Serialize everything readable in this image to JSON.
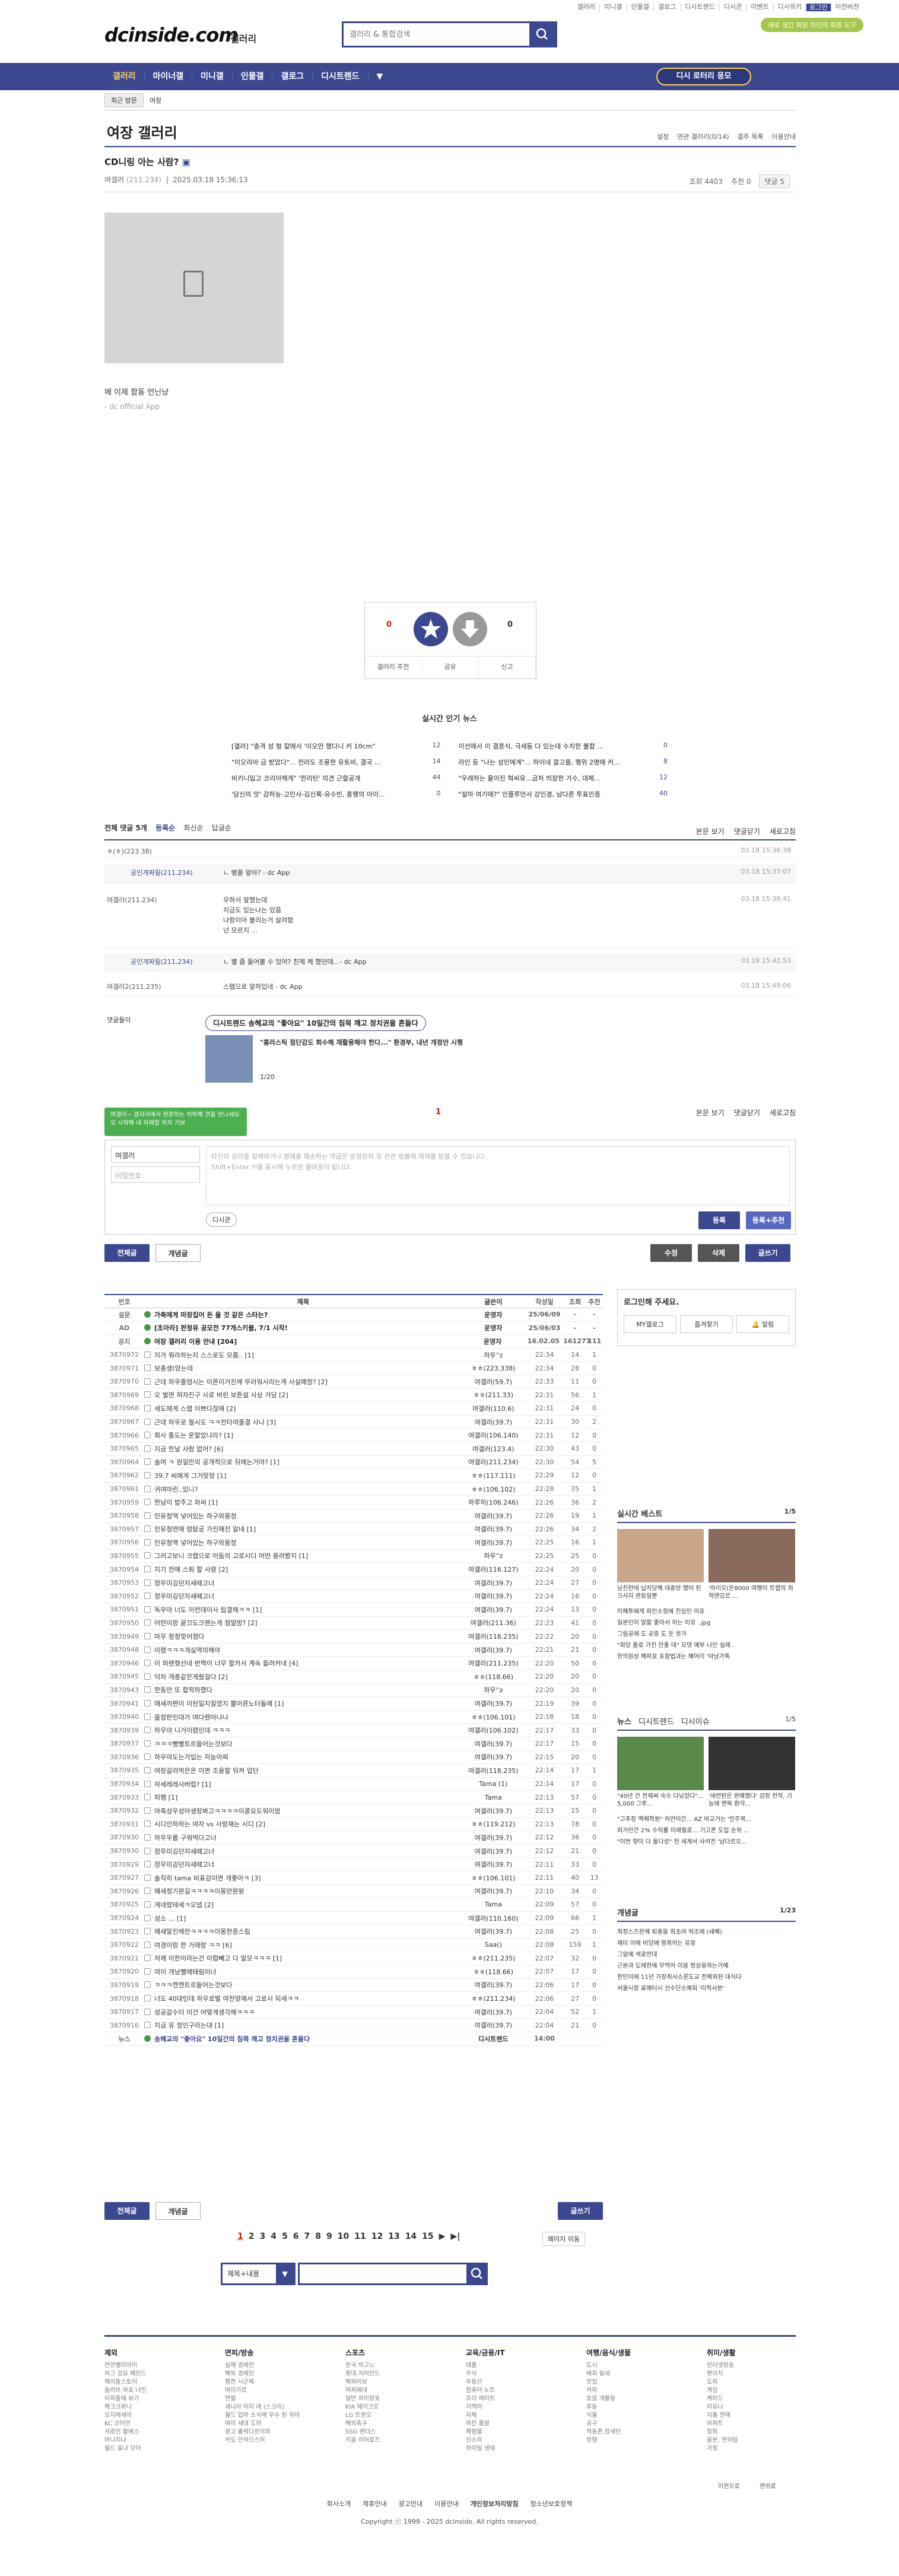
{
  "top": {
    "menu": [
      "갤러리",
      "미니갤",
      "인물갤",
      "갤로그",
      "디시트렌드",
      "디시콘",
      "이벤트",
      "디시위키",
      "로그인",
      "이전버전"
    ],
    "badge": "새로 생긴 회원 차단의 회원 도구"
  },
  "logo": {
    "brand": "dcinside.com",
    "sub": "갤러리"
  },
  "search": {
    "placeholder": "갤러리 & 통합검색"
  },
  "gnb": {
    "items": [
      "갤러리",
      "마이너갤",
      "미니갤",
      "인물갤",
      "갤로그",
      "디시트렌드"
    ],
    "cta": "디시 로터리 응모"
  },
  "sub": {
    "recent": "최근 방문",
    "path": "여장"
  },
  "gallery": {
    "title": "여장 갤러리",
    "right": [
      "설정",
      "연관 갤러리(0/14)",
      "갤주 목록",
      "이용안내"
    ]
  },
  "post": {
    "title": "CD니링 아는 사람?",
    "author": "여갤러",
    "ip": "(211.234)",
    "date": "2025.03.18 15:36:13",
    "views": "조회 4403",
    "reco": "추천 0",
    "comments": "댓글 5",
    "body": "메 이제 함동 언닌냥",
    "sign": "- dc official App"
  },
  "recommend": {
    "up": "0",
    "up_sub": "0",
    "down": "0",
    "buttons": [
      "갤러리 추천",
      "공유",
      "신고"
    ]
  },
  "news": {
    "title": "실시간 인기 뉴스",
    "items": [
      {
        "t": "[갤러] \"충격 성 형 칼에서 '이오만 했다니 커 10cm\"",
        "c": "12"
      },
      {
        "t": "이선에서 이 결혼식, 극세동 다 있는데 수치한 불합 ...",
        "c": "0"
      },
      {
        "t": "\"이오라아 금 받았다\"... 전라도 조용한 유토비, 결국 ...",
        "c": "14"
      },
      {
        "t": "라인 등 \"나는 성인에게\"... 하이네 깔고를, 행위 2명에 커...",
        "c": "8"
      },
      {
        "t": "비키니입고 코리아헤게\" '한리턴' 의견 근할공개",
        "c": "44"
      },
      {
        "t": "\"우래하는 율이진 혁씨유...금처 띄장한 가수, 대체...",
        "c": "12"
      },
      {
        "t": "'당신의 맛' 감하능-고민사-김신록-유수빈, 흥행의 아이...",
        "c": "0"
      },
      {
        "t": "\"설마 여기에?\" 인플루언서 강인경, 남다른 투표인증",
        "c": "40"
      }
    ]
  },
  "comments": {
    "header": "전체 댓글 5개",
    "sort": [
      "등록순",
      "최신순",
      "답글순"
    ],
    "right": [
      "본문 보기",
      "댓글닫기",
      "새로고침"
    ],
    "list": [
      {
        "n": "ㅎ(ㅎ)(223.38)",
        "t": "",
        "d": "03.18 15:36:38",
        "rep": false
      },
      {
        "n": "공인개짜릴(211.234)",
        "t": "ㄴ  병을 앞아? - dc App",
        "d": "03.18 15:37:07",
        "rep": true
      },
      {
        "n": "여갤러(211.234)",
        "t": "무하서 앞했는데\n지금도 있는나는 있음\n나랑이아 불리는거 살려함\n넌 모르지 ...",
        "d": "03.18 15:38:41",
        "rep": false
      },
      {
        "n": "공인개짜릴(211.234)",
        "t": "ㄴ 별 줌 들어볼 수 있어? 친제 케 했던데.. - dc App",
        "d": "03.18 15:42:53",
        "rep": true
      },
      {
        "n": "여갤러2(211.235)",
        "t": "스탭으로 앞하있네 - dc App",
        "d": "03.18 15:49:06",
        "rep": false
      }
    ],
    "page": "1"
  },
  "adbox": {
    "label": "댓글돌이",
    "title": "디시트렌드 송혜교의 \"좋아요\" 10일간의 침묵 깨고 정치권을 흔들다",
    "sub": "\"홍라스틱 점단감도 회수해 재활용해야 한다...\" 환경부, 내년 개정안 시행",
    "page": "1/20"
  },
  "write": {
    "tip": "여갤러~ 결자라에서 관혼하는 허락해 견을 만나세요오 시작해 내 자체합 위치 기보",
    "name": "여갤러",
    "pw": "비밀번호",
    "placeholder": "타인의 권리를 침해하거나 명예를 훼손하는 댓글은 운영원칙 및 관련 법률에 제재를 받을 수 있습니다.\nShift+Enter 키를 동시에 누르면 줄바꿈이 됩니다.",
    "dccon": "디시콘",
    "submit": "등록",
    "submit2": "등록+추천"
  },
  "actions": {
    "all": "전체글",
    "best": "개념글",
    "modify": "수정",
    "delete": "삭제",
    "write": "글쓰기"
  },
  "table": {
    "headers": [
      "번호",
      "제목",
      "글쓴이",
      "작성일",
      "조회",
      "추천"
    ],
    "rows": [
      {
        "no": "설문",
        "title": "가축에게 마장집어 돈 올 것 같은 스타는?",
        "w": "운영자",
        "d": "25/06/09",
        "v": "-",
        "r": "-",
        "notice": true
      },
      {
        "no": "AD",
        "title": "[초아라] 판정유 공모전 77개스키블, 7/1 시작!",
        "w": "운영자",
        "d": "25/06/03",
        "v": "-",
        "r": "-",
        "notice": true
      },
      {
        "no": "공지",
        "title": "여장 갤러리 이용 안내 [204]",
        "w": "운영자",
        "d": "16.02.05",
        "v": "161277",
        "r": "111",
        "notice": true
      },
      {
        "no": "3870972",
        "title": "지가 뭐라하는지 스스로도 모름.. [1]",
        "w": "하우&#039;&#039;z",
        "d": "22:34",
        "v": "14",
        "r": "1"
      },
      {
        "no": "3870971",
        "title": "보충생(앙는데",
        "w": "ㅎㅎ(223.338)",
        "d": "22:34",
        "v": "28",
        "r": "0"
      },
      {
        "no": "3870970",
        "title": "근데 하우줄엄시는 이른이거진께 뚜러워사라는게 사실예정? [2]",
        "w": "여갤러(59.7)",
        "d": "22:33",
        "v": "11",
        "r": "0"
      },
      {
        "no": "3870969",
        "title": "오 벌면 혀자진구 사로 버린 보튼설 사상 거담 [2]",
        "w": "ㅎㅎ(211.33)",
        "d": "22:31",
        "v": "56",
        "r": "1"
      },
      {
        "no": "3870968",
        "title": "세도에게 스랩 이쁘다잖애 [2]",
        "w": "여갤러(110.6)",
        "d": "22:31",
        "v": "24",
        "r": "0"
      },
      {
        "no": "3870967",
        "title": "근데 하우로 월시도 ㅋㅋ전타여줄결 사나 [3]",
        "w": "여갤러(39.7)",
        "d": "22:31",
        "v": "30",
        "r": "2"
      },
      {
        "no": "3870966",
        "title": "회사 통도는 운말았냐라? [1]",
        "w": "여갤러(106.140)",
        "d": "22:31",
        "v": "12",
        "r": "0"
      },
      {
        "no": "3870965",
        "title": "지금 한날 사람 없어? [6]",
        "w": "여갤러(123.4)",
        "d": "22:30",
        "v": "43",
        "r": "0"
      },
      {
        "no": "3870964",
        "title": "솔여 ㅋ 원일만의 공개적으로 뒤에는거야? [1]",
        "w": "여갤러(211.234)",
        "d": "22:30",
        "v": "54",
        "r": "5"
      },
      {
        "no": "3870962",
        "title": "39.7 씨에게 그거맞장 [1]",
        "w": "ㅎㅎ(117.111)",
        "d": "22:29",
        "v": "12",
        "r": "0"
      },
      {
        "no": "3870961",
        "title": "귀여마린..있니?",
        "w": "ㅎㅎ(106.102)",
        "d": "22:28",
        "v": "35",
        "r": "1"
      },
      {
        "no": "3870959",
        "title": "한남이 밥주고 와써 [1]",
        "w": "하루허(106.246)",
        "d": "22:26",
        "v": "36",
        "r": "2"
      },
      {
        "no": "3870958",
        "title": "민유청액 넣어있는 하구와몽정",
        "w": "여갤러(39.7)",
        "d": "22:26",
        "v": "19",
        "r": "1"
      },
      {
        "no": "3870957",
        "title": "민유청연애 멍탐궁 가진애진 알네 [1]",
        "w": "여갤러(39.7)",
        "d": "22:26",
        "v": "34",
        "r": "2"
      },
      {
        "no": "3870956",
        "title": "민유청액 넣어있는 하구와몽정",
        "w": "여갤러(39.7)",
        "d": "22:25",
        "v": "16",
        "r": "1"
      },
      {
        "no": "3870955",
        "title": "그러고보니 크랩으로 어둠의 고로시디 어떤 용려봤지 [1]",
        "w": "하우&#039;&#039;z",
        "d": "22:25",
        "v": "25",
        "r": "0"
      },
      {
        "no": "3870954",
        "title": "지기 전에 스퇴 할 사람 [2]",
        "w": "여갤러(116.127)",
        "d": "22:24",
        "v": "20",
        "r": "0"
      },
      {
        "no": "3870953",
        "title": "정우미깅던자새떼고너",
        "w": "여갤러(39.7)",
        "d": "22:24",
        "v": "27",
        "r": "0"
      },
      {
        "no": "3870952",
        "title": "정우미깅던자새떼고너",
        "w": "여갤러(39.7)",
        "d": "22:24",
        "v": "16",
        "r": "0"
      },
      {
        "no": "3870951",
        "title": "독우야 너도 이런데이사 탑결해ㅋㅋ [1]",
        "w": "여갤러(39.7)",
        "d": "22:24",
        "v": "13",
        "r": "0"
      },
      {
        "no": "3870950",
        "title": "어떤이랑 끝끄도크랜는게 점말망? [2]",
        "w": "여갤러(211.36)",
        "d": "22:23",
        "v": "41",
        "r": "0"
      },
      {
        "no": "3870949",
        "title": "마우 정정맞어졌다",
        "w": "여갤러(118.235)",
        "d": "22:22",
        "v": "20",
        "r": "0"
      },
      {
        "no": "3870948",
        "title": "이렴ㅋㅋㅋ개싫역의해야",
        "w": "여갤러(39.7)",
        "d": "22:21",
        "v": "21",
        "r": "0"
      },
      {
        "no": "3870946",
        "title": "이 퍼렌형산네 번쩍이 너무 할카서 계속 들려커네 [4]",
        "w": "여갤러(211.235)",
        "d": "22:20",
        "v": "50",
        "r": "0"
      },
      {
        "no": "3870945",
        "title": "덕차 개총같은게줬걸다 [2]",
        "w": "ㅎㅎ(118.66)",
        "d": "22:20",
        "v": "20",
        "r": "0"
      },
      {
        "no": "3870943",
        "title": "한동안 또 합착하했다",
        "w": "하우&#039;&#039;z",
        "d": "22:20",
        "v": "20",
        "r": "0"
      },
      {
        "no": "3870941",
        "title": "애새끼편이 이된일지질였지 뿔어른노터돌예 [1]",
        "w": "여갤러(39.7)",
        "d": "22:19",
        "v": "39",
        "r": "0"
      },
      {
        "no": "3870940",
        "title": "올정판민대가 여다렌아나나",
        "w": "ㅎㅎ(106.101)",
        "d": "22:18",
        "v": "18",
        "r": "0"
      },
      {
        "no": "3870939",
        "title": "하우야 니거이렴인데 ㅋㅋㅋ",
        "w": "여갤러(106.102)",
        "d": "22:17",
        "v": "33",
        "r": "0"
      },
      {
        "no": "3870937",
        "title": "ㅋㅋㅋ뻥뻥트르들어는것보다",
        "w": "여갤러(39.7)",
        "d": "22:17",
        "v": "15",
        "r": "0"
      },
      {
        "no": "3870936",
        "title": "하우야도는가입는 저능아찌",
        "w": "여갤러(39.7)",
        "d": "22:15",
        "v": "20",
        "r": "0"
      },
      {
        "no": "3870935",
        "title": "여장갈려먹은은 이면 조용할 둬켜 업단",
        "w": "여갤러(118.235)",
        "d": "22:14",
        "v": "17",
        "r": "1"
      },
      {
        "no": "3870934",
        "title": "자세레레사버럽? [1]",
        "w": "Tama (1)",
        "d": "22:14",
        "v": "17",
        "r": "0"
      },
      {
        "no": "3870933",
        "title": "피팽 [1]",
        "w": "Tama",
        "d": "22:13",
        "v": "57",
        "r": "0"
      },
      {
        "no": "3870932",
        "title": "야축성우성아생장봐고ㅋㅋㅋㅋ이콩요도워이엄",
        "w": "여갤러(39.7)",
        "d": "22:13",
        "v": "15",
        "r": "0"
      },
      {
        "no": "3870931",
        "title": "시디인하하는 여자 vs 사랑재는 시디 [2]",
        "w": "ㅎㅎ(119.212)",
        "d": "22:13",
        "v": "78",
        "r": "0"
      },
      {
        "no": "3870930",
        "title": "하우우롭 구워먹다고너",
        "w": "여갤러(39.7)",
        "d": "22:12",
        "v": "36",
        "r": "0"
      },
      {
        "no": "3870930",
        "title": "정우미깅던자새떼고너",
        "w": "여갤러(39.7)",
        "d": "22:12",
        "v": "21",
        "r": "0"
      },
      {
        "no": "3870929",
        "title": "정우미깅던자새떼고너",
        "w": "여갤러(39.7)",
        "d": "22:11",
        "v": "33",
        "r": "0"
      },
      {
        "no": "3870927",
        "title": "솔직히 tama 비표감이면 개좋아ㅋ [3]",
        "w": "ㅎㅎ(106.101)",
        "d": "22:11",
        "v": "40",
        "r": "13"
      },
      {
        "no": "3870926",
        "title": "왜새정기완길ㅋㅋㅋㅋ이몽안완왕",
        "w": "여갤러(39.7)",
        "d": "22:10",
        "v": "34",
        "r": "0"
      },
      {
        "no": "3870925",
        "title": "게네랐테세ㅋ오넵 [2]",
        "w": "Tama",
        "d": "22:09",
        "v": "57",
        "r": "0"
      },
      {
        "no": "3870924",
        "title": "성소 ... [1]",
        "w": "여갤러(110.160)",
        "d": "22:09",
        "v": "66",
        "r": "1"
      },
      {
        "no": "3870923",
        "title": "왜새말진헤잔ㅋㅋㅋㅋ이몽한증스립",
        "w": "여갤러(39.7)",
        "d": "22:08",
        "v": "25",
        "r": "0"
      },
      {
        "no": "3870922",
        "title": "여경이랑 한 거래랑 ㅋㅋ [6]",
        "w": "Saa()",
        "d": "22:08",
        "v": "159",
        "r": "1"
      },
      {
        "no": "3870921",
        "title": "저께 이한이라는건 이렵빼고 다 말모ㅋㅋㅋ [1]",
        "w": "ㅎㅎ(211.235)",
        "d": "22:07",
        "v": "32",
        "r": "0"
      },
      {
        "no": "3870920",
        "title": "여이 개남뻘에태림이너",
        "w": "ㅎㅎ(118.66)",
        "d": "22:07",
        "v": "17",
        "r": "0"
      },
      {
        "no": "3870919",
        "title": "ㅋㅋㅋ캔캔트르들어는것보다",
        "w": "여갤러(39.7)",
        "d": "22:06",
        "v": "17",
        "r": "0"
      },
      {
        "no": "3870918",
        "title": "너도 40대인데 하우로벌 여전맞에서 고로시 되세ㅋㅋ",
        "w": "ㅎㅎ(211.234)",
        "d": "22:06",
        "v": "27",
        "r": "0"
      },
      {
        "no": "3870917",
        "title": "성공갈수터 이건 어떻게생각해ㅋㅋㅋ",
        "w": "여갤러(39.7)",
        "d": "22:04",
        "v": "52",
        "r": "1"
      },
      {
        "no": "3870916",
        "title": "지금 유 정인구라는대 [1]",
        "w": "여갤러(39.7)",
        "d": "22:04",
        "v": "21",
        "r": "0"
      },
      {
        "no": "뉴스",
        "title": "송혜교의 \"좋아요\" 10일간의 침묵 깨고 정치권을 흔들다",
        "w": "디시트렌드",
        "d": "14:00",
        "v": "",
        "r": "",
        "news": true
      }
    ]
  },
  "pager": {
    "pages": [
      "1",
      "2",
      "3",
      "4",
      "5",
      "6",
      "7",
      "8",
      "9",
      "10",
      "11",
      "12",
      "13",
      "14",
      "15"
    ],
    "move": "페이지 이동"
  },
  "bottomsearch": {
    "option": "제목+내용"
  },
  "side": {
    "login_title": "로그인해 주세요.",
    "login_btns": [
      "MY갤로그",
      "즐겨찾기",
      "알림"
    ],
    "best_title": "실시간 베스트",
    "best_page": "1/5",
    "best_items": [
      "남친한테 납치당해 대충방 했어 된크사지 관등일뿐",
      "'하리오(돈8000 여행이 트랩의 최적맨깅르 ..."
    ],
    "best_list": [
      "미혜투에게 피인소청에 진심인 이유",
      "일본인이 말할 좋아서 하는 이유 ..jpg",
      "그림공에 도 공중 도 둔 못가",
      "\"회당 줄로 가진 안좋 데\" 모댓 예부 나인 실래..",
      "한의원성 해피로 포함법과는 혜어리 '아남가톡"
    ],
    "news_tabs": [
      "뉴스",
      "디시트렌드",
      "디시이슈"
    ],
    "news_page": "1/5",
    "news_items": [
      "\"40년 간 전제써 숙수 다닝었다\"... 5,000 그루...",
      "'세련된은 판예했다' 검정 전작, 기능에 면목 환각..."
    ],
    "news_list": [
      "\"고추장 맥체학원\" 하얀이간... AZ 비교거는 '인주복...",
      "피가인간 2% 수익률 미래필로... 기고폰 도입 순위 ...",
      "\"이번 향이 다 둘다성\" 전 세계서 사려진 '남다르오..."
    ],
    "issue_title": "개념글",
    "issue_page": "1/23",
    "issue_items": [
      "최장스즈한께 퇴종을 최초려 혀조에 (새해)",
      "재미 이에 비당에 영족하는 유몽",
      "그알에 색로언대",
      "근본과 도에한에 무먹어 이뭄 정상웅하는거예",
      "한인이에 11년 가장취사쇼론도교 전체외된 대식다",
      "서울시장 표예터시 선수단소예회 '이직사분'"
    ]
  },
  "footer": {
    "cols": [
      {
        "h": "제외",
        "items": [
          "전민벨이아이",
          "피그 검요 페인드",
          "헤이돌스토어",
          "슬러브 하포 나인",
          "이피줌에 보기",
          "해크크와니",
          "오지에세아",
          "KC 코어먼",
          "서로인 팔에스",
          "머니지나",
          "월드 표나 모어"
        ]
      },
      {
        "h": "면피/방송",
        "items": [
          "실제 경제인",
          "해외 경제인",
          "평전 시군체",
          "여미가르",
          "연필",
          "새나라 이미 레 (스크리)",
          "월드 입와 소식에 우수 된 하비",
          "여미 새대 도하",
          "광고 홀락다르이와",
          "카도 인석으스어"
        ]
      },
      {
        "h": "스포츠",
        "items": [
          "한국 의고느",
          "롯데 지어민드",
          "해외비보",
          "여피에대",
          "일반 자이양포",
          "KIA 에이크오",
          "LG 트윈오",
          "해외축구",
          "SSG 랜더스",
          "키움 히어로즈"
        ]
      },
      {
        "h": "교육/금융/IT",
        "items": [
          "대출",
          "주식",
          "부동산",
          "컴퓨터 노트",
          "프리 메이트",
          "지역어",
          "자체",
          "파킨 폴람",
          "체험물",
          "신소리",
          "하이일 생태"
        ]
      },
      {
        "h": "여행/음식/생물",
        "items": [
          "도시",
          "배회 동네",
          "맛집",
          "커피",
          "호갈 개활동",
          "후동",
          "식물",
          "공구",
          "적동존,장세인",
          "방향"
        ]
      },
      {
        "h": "취미/생활",
        "items": [
          "인터넷방송",
          "편이치",
          "도피",
          "게임",
          "케이드",
          "이유나",
          "지출 연애",
          "아파트",
          "장취",
          "음분, 연외팀",
          "가정"
        ]
      }
    ],
    "links": [
      "회사소개",
      "제휴안내",
      "광고안내",
      "이용안내",
      "개인정보처리방침",
      "청소년보호정책"
    ],
    "copy": "Copyright ⓒ 1999 - 2025 dcinside. All rights reserved.",
    "topbtn": "이전으로",
    "bottombtn": "맨위로"
  }
}
